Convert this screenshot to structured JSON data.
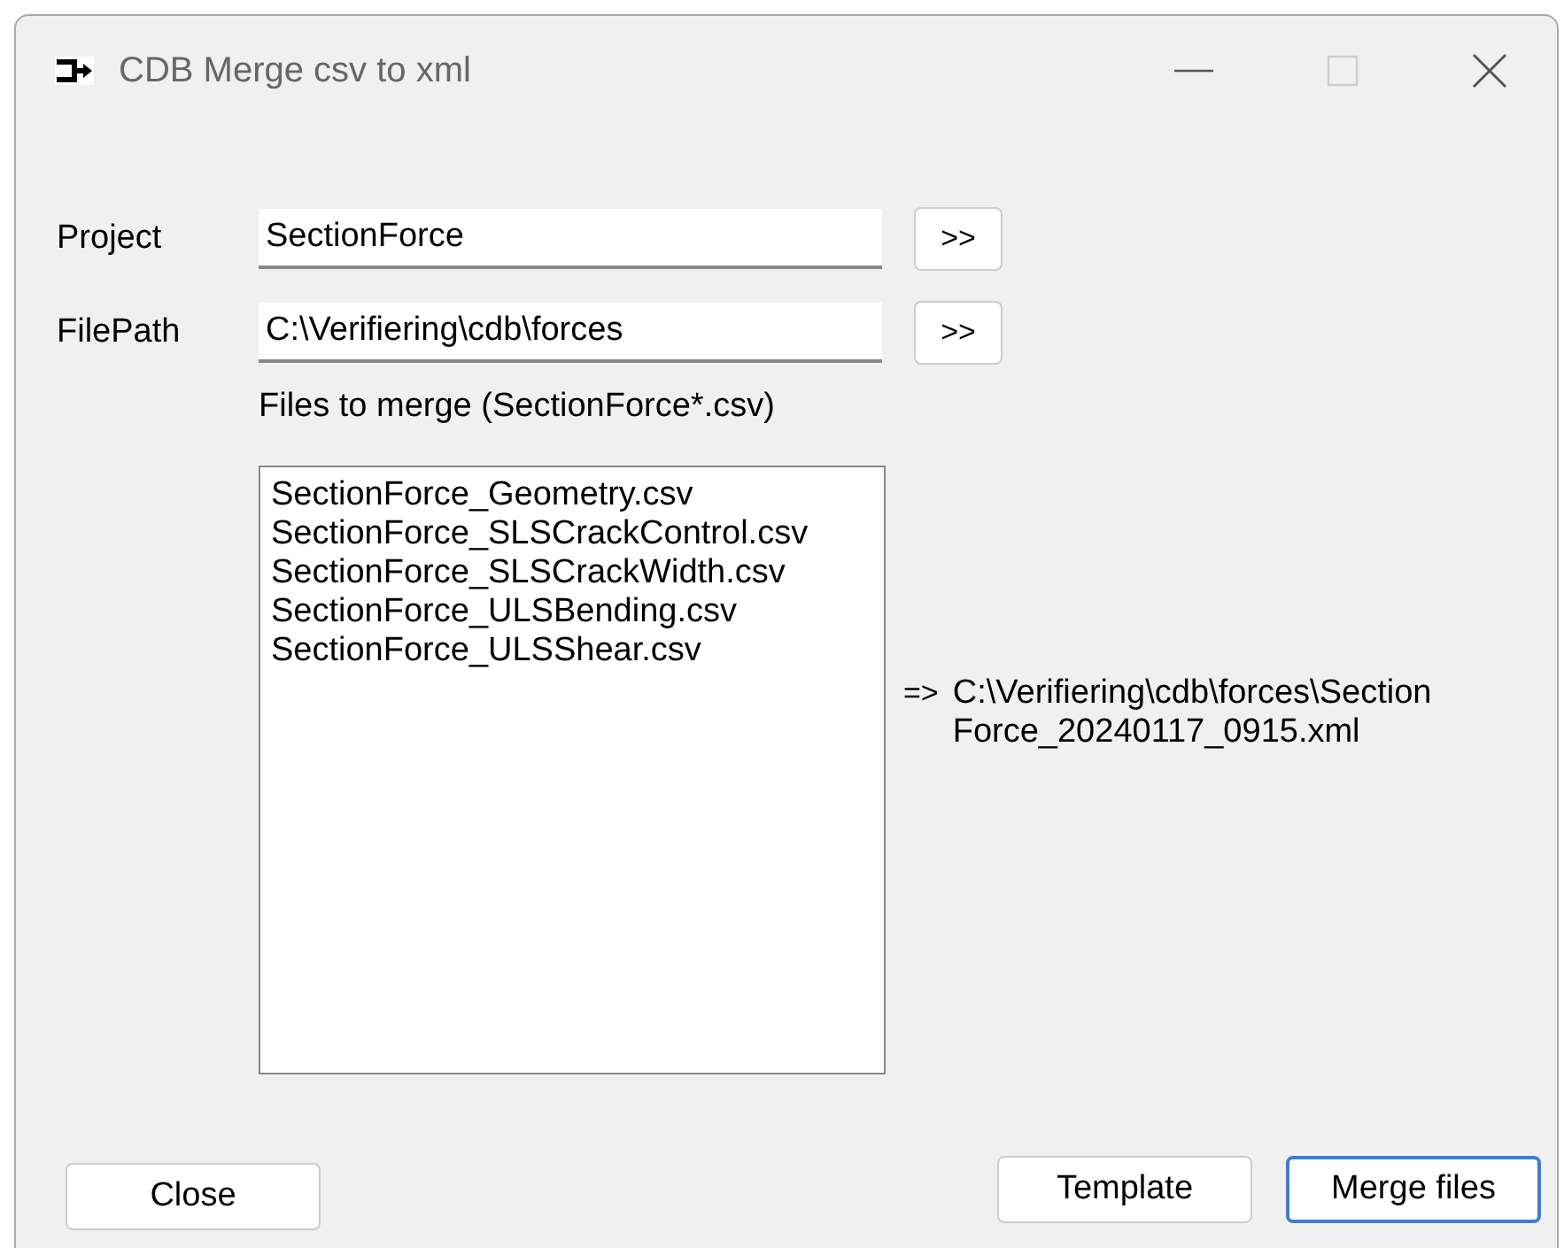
{
  "window": {
    "title": "CDB Merge csv to xml"
  },
  "fields": [
    {
      "label": "Project",
      "value": "SectionForce",
      "button": ">>"
    },
    {
      "label": "FilePath",
      "value": "C:\\Verifiering\\cdb\\forces",
      "button": ">>"
    }
  ],
  "files_label": "Files to merge (SectionForce*.csv)",
  "files": [
    "SectionForce_Geometry.csv",
    "SectionForce_SLSCrackControl.csv",
    "SectionForce_SLSCrackWidth.csv",
    "SectionForce_ULSBending.csv",
    "SectionForce_ULSShear.csv"
  ],
  "output": {
    "prefix": "=>",
    "lines": [
      "C:\\Verifiering\\cdb\\forces\\Section",
      "Force_20240117_0915.xml"
    ]
  },
  "buttons": [
    {
      "label": "Close",
      "default": false
    },
    {
      "label": "Template",
      "default": false
    },
    {
      "label": "Merge files",
      "default": true
    }
  ]
}
